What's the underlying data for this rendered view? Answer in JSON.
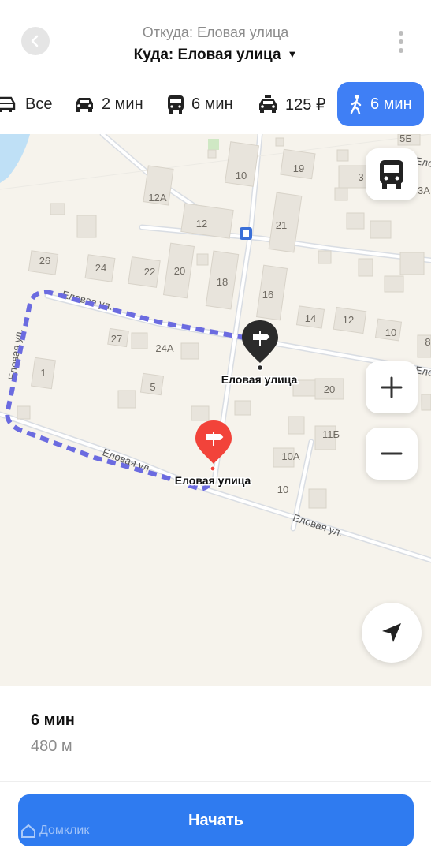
{
  "header": {
    "from": "Откуда: Еловая улица",
    "to": "Куда: Еловая улица"
  },
  "modes": [
    {
      "label": "Все",
      "icon": "transport-icon"
    },
    {
      "label": "2 мин",
      "icon": "car-icon"
    },
    {
      "label": "6 мин",
      "icon": "bus-icon"
    },
    {
      "label": "125 ₽",
      "icon": "taxi-icon"
    },
    {
      "label": "6 мин",
      "icon": "walk-icon",
      "active": true
    }
  ],
  "map": {
    "street_labels": [
      "Еловая ул.",
      "Еловая ул.",
      "Еловая ул.",
      "Еловая ул.",
      "Ело",
      "Ело"
    ],
    "house_numbers": [
      "10",
      "19",
      "12А",
      "12",
      "21",
      "26",
      "24",
      "22",
      "20",
      "18",
      "16",
      "14",
      "12",
      "10",
      "27",
      "24А",
      "1",
      "5",
      "20",
      "11Б",
      "10А",
      "10",
      "3",
      "3А",
      "5Б",
      "1",
      "8"
    ],
    "start_label": "Еловая улица",
    "end_label": "Еловая улица",
    "route_color": "#6b6be0",
    "start_pin_color": "#2b2b2b",
    "end_pin_color": "#f2433a"
  },
  "summary": {
    "time": "6 мин",
    "distance": "480 м"
  },
  "start_button": "Начать",
  "watermark": "Домклик"
}
